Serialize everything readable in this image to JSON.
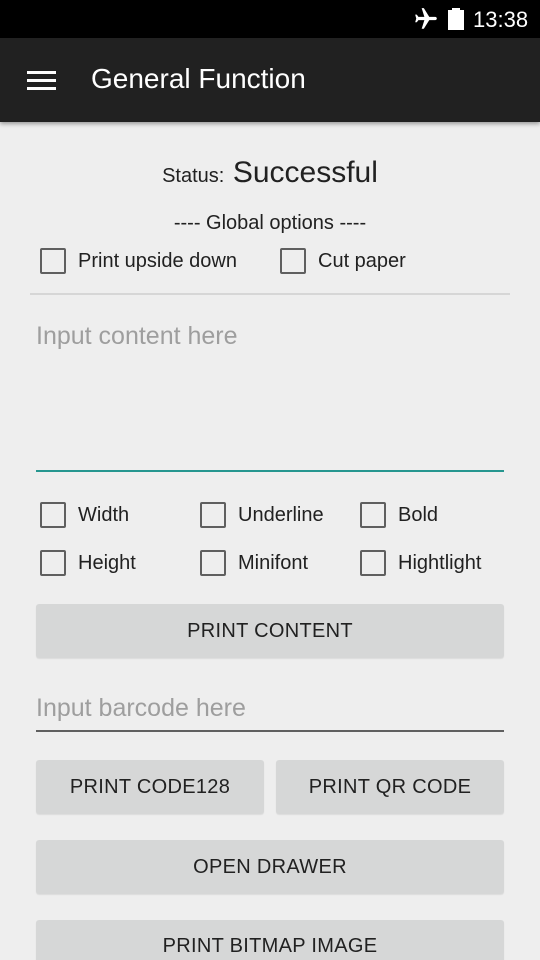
{
  "status_bar": {
    "time": "13:38",
    "icons": [
      "airplane-mode-icon",
      "battery-icon"
    ]
  },
  "app_bar": {
    "title": "General Function",
    "menu_icon": "hamburger-menu-icon"
  },
  "status": {
    "label": "Status:",
    "value": "Successful"
  },
  "global_options": {
    "label": "---- Global options ----",
    "print_upside_down": "Print upside down",
    "cut_paper": "Cut paper"
  },
  "content_input": {
    "placeholder": "Input content here",
    "value": ""
  },
  "format_options": {
    "width": "Width",
    "underline": "Underline",
    "bold": "Bold",
    "height": "Height",
    "minifont": "Minifont",
    "highlight": "Hightlight"
  },
  "buttons": {
    "print_content": "PRINT CONTENT",
    "print_code128": "PRINT CODE128",
    "print_qr_code": "PRINT QR CODE",
    "open_drawer": "OPEN DRAWER",
    "print_bitmap_image": "PRINT BITMAP IMAGE"
  },
  "barcode_input": {
    "placeholder": "Input barcode here",
    "value": ""
  },
  "colors": {
    "app_bar": "#212121",
    "status_bar": "#000000",
    "background": "#eeeeee",
    "accent_underline": "#26968f",
    "button": "#d6d7d7"
  }
}
